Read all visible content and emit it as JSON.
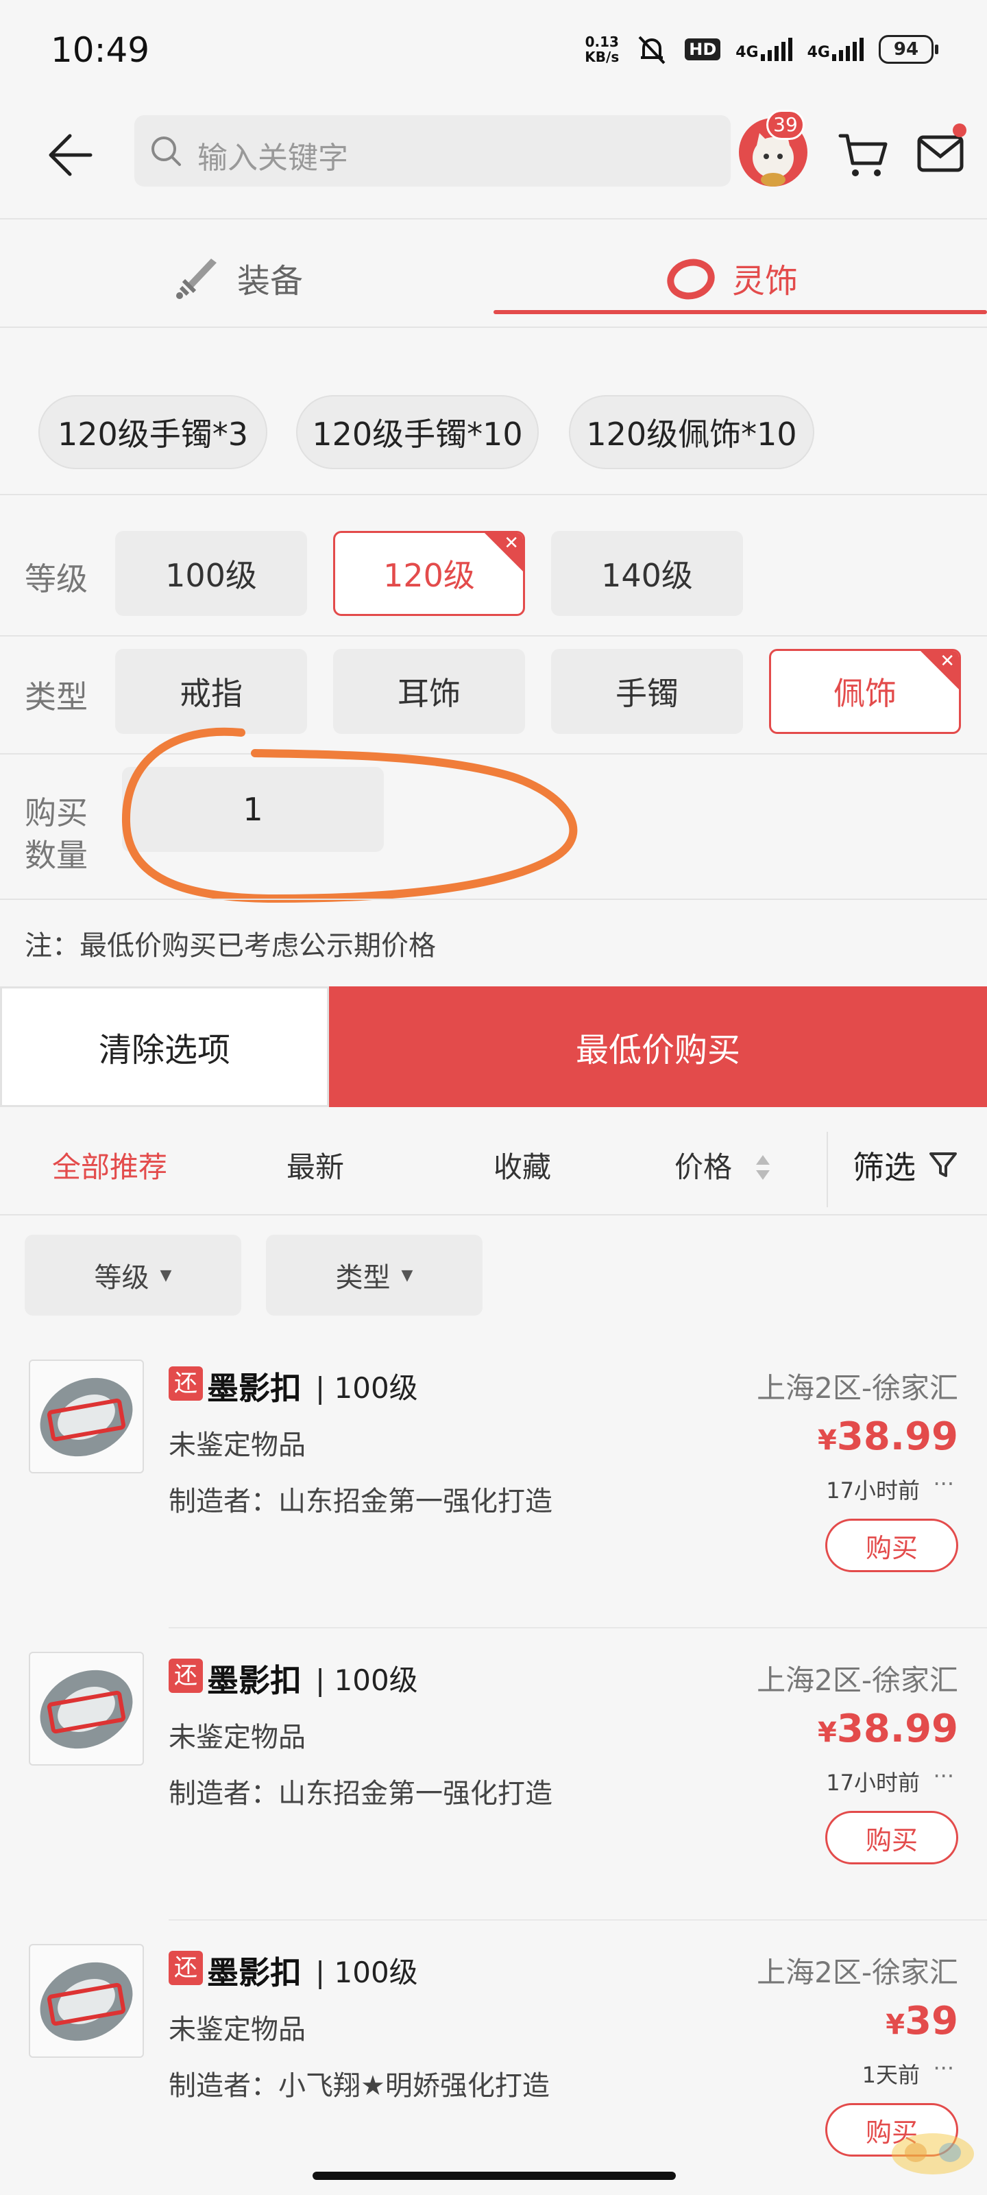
{
  "status_bar": {
    "time": "10:49",
    "speed_value": "0.13",
    "speed_unit": "KB/s",
    "hd": "HD",
    "net1": "4G",
    "net2": "4G",
    "battery": "94"
  },
  "header": {
    "search_placeholder": "输入关键字",
    "avatar_badge": "39"
  },
  "categories": [
    {
      "label": "装备"
    },
    {
      "label": "灵饰"
    }
  ],
  "quick_chips": [
    "120级手镯*3",
    "120级手镯*10",
    "120级佩饰*10"
  ],
  "filters": {
    "level": {
      "label": "等级",
      "options": [
        "100级",
        "120级",
        "140级"
      ],
      "selected": "120级"
    },
    "type": {
      "label": "类型",
      "options": [
        "戒指",
        "耳饰",
        "手镯",
        "佩饰"
      ],
      "selected": "佩饰"
    },
    "quantity": {
      "label_line1": "购买",
      "label_line2": "数量",
      "value": "1"
    }
  },
  "note": "注：最低价购买已考虑公示期价格",
  "actions": {
    "clear": "清除选项",
    "buy_lowest": "最低价购买"
  },
  "sort_tabs": [
    "全部推荐",
    "最新",
    "收藏",
    "价格"
  ],
  "filter_label": "筛选",
  "dropdowns": [
    "等级",
    "类型"
  ],
  "listings": [
    {
      "tag": "还",
      "name": "墨影扣",
      "level": "| 100级",
      "server": "上海2区-徐家汇",
      "status": "未鉴定物品",
      "maker": "制造者：山东招金第一强化打造",
      "currency": "¥",
      "price": "38.99",
      "time": "17小时前",
      "more": "···",
      "buy": "购买"
    },
    {
      "tag": "还",
      "name": "墨影扣",
      "level": "| 100级",
      "server": "上海2区-徐家汇",
      "status": "未鉴定物品",
      "maker": "制造者：山东招金第一强化打造",
      "currency": "¥",
      "price": "38.99",
      "time": "17小时前",
      "more": "···",
      "buy": "购买"
    },
    {
      "tag": "还",
      "name": "墨影扣",
      "level": "| 100级",
      "server": "上海2区-徐家汇",
      "status": "未鉴定物品",
      "maker": "制造者：小飞翔★明娇强化打造",
      "currency": "¥",
      "price": "39",
      "time": "1天前",
      "more": "···",
      "buy": "购买"
    }
  ],
  "colors": {
    "accent": "#e34b4b",
    "annotation": "#f07d3a",
    "background": "#f6f6f6"
  }
}
